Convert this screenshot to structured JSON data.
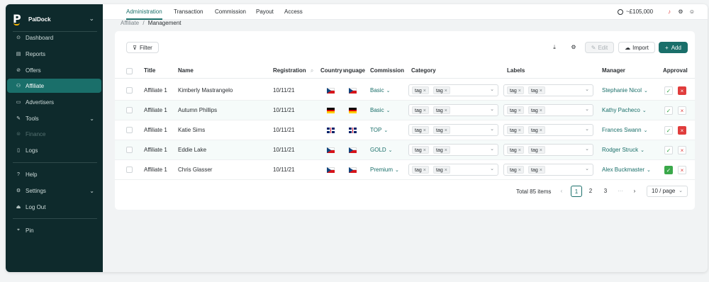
{
  "app": {
    "name": "PalDock"
  },
  "sidebar": {
    "items": [
      {
        "label": "Dashboard",
        "icon": "dashboard-icon"
      },
      {
        "label": "Reports",
        "icon": "reports-icon"
      },
      {
        "label": "Offers",
        "icon": "offers-icon"
      },
      {
        "label": "Affiliate",
        "icon": "affiliate-icon"
      },
      {
        "label": "Advertisers",
        "icon": "advertisers-icon"
      },
      {
        "label": "Tools",
        "icon": "tools-icon"
      },
      {
        "label": "Finance",
        "icon": "finance-icon"
      },
      {
        "label": "Logs",
        "icon": "logs-icon"
      },
      {
        "label": "Help",
        "icon": "help-icon"
      },
      {
        "label": "Settings",
        "icon": "settings-icon"
      },
      {
        "label": "Log Out",
        "icon": "logout-icon"
      },
      {
        "label": "Pin",
        "icon": "pin-icon"
      }
    ]
  },
  "topnav": {
    "tabs": [
      "Administration",
      "Transaction",
      "Commission",
      "Payout",
      "Access"
    ],
    "balance": "~£105,000"
  },
  "breadcrumb": {
    "parent": "Affiliate",
    "separator": "/",
    "current": "Management"
  },
  "toolbar": {
    "filter": "Filter",
    "edit": "Edit",
    "import": "Import",
    "add": "Add"
  },
  "table": {
    "headers": [
      "Title",
      "Name",
      "Registration",
      "Country",
      "Language",
      "Commission",
      "Category",
      "Labels",
      "Manager",
      "Approval"
    ],
    "rows": [
      {
        "title": "Affiliate 1",
        "name": "Kimberly Mastrangelo",
        "registration": "10/11/21",
        "country": "cz",
        "language": "cz",
        "commission": "Basic",
        "category": [
          "tag",
          "tag"
        ],
        "labels": [
          "tag",
          "tag"
        ],
        "manager": "Stephanie Nicol",
        "approved": false,
        "rejected": true
      },
      {
        "title": "Affiliate 1",
        "name": "Autumn Phillips",
        "registration": "10/11/21",
        "country": "de",
        "language": "de",
        "commission": "Basic",
        "category": [
          "tag",
          "tag"
        ],
        "labels": [
          "tag",
          "tag"
        ],
        "manager": "Kathy Pacheco",
        "approved": false,
        "rejected": false
      },
      {
        "title": "Affiliate 1",
        "name": "Katie Sims",
        "registration": "10/11/21",
        "country": "gb",
        "language": "gb",
        "commission": "TOP",
        "category": [
          "tag",
          "tag"
        ],
        "labels": [
          "tag",
          "tag"
        ],
        "manager": "Frances Swann",
        "approved": false,
        "rejected": true
      },
      {
        "title": "Affiliate 1",
        "name": "Eddie Lake",
        "registration": "10/11/21",
        "country": "cz",
        "language": "cz",
        "commission": "GOLD",
        "category": [
          "tag",
          "tag"
        ],
        "labels": [
          "tag",
          "tag"
        ],
        "manager": "Rodger Struck",
        "approved": false,
        "rejected": false
      },
      {
        "title": "Affiliate 1",
        "name": "Chris Glasser",
        "registration": "10/11/21",
        "country": "cz",
        "language": "cz",
        "commission": "Premium",
        "category": [
          "tag",
          "tag"
        ],
        "labels": [
          "tag",
          "tag"
        ],
        "manager": "Alex Buckmaster",
        "approved": true,
        "rejected": false
      }
    ]
  },
  "pagination": {
    "total": "Total 85 items",
    "pages": [
      "1",
      "2",
      "3"
    ],
    "ellipsis": "···",
    "page_size": "10 / page"
  }
}
